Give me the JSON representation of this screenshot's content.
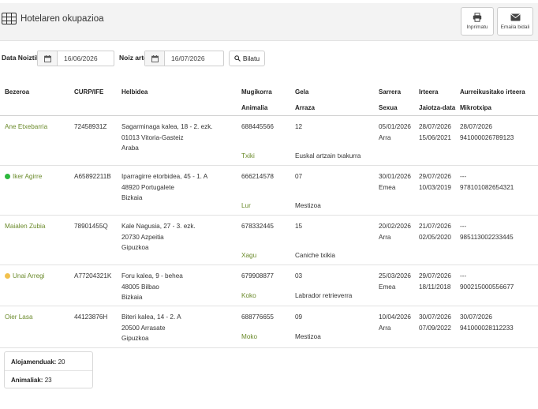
{
  "header": {
    "title": "Hotelaren okupazioa",
    "print_label": "Inprimatu",
    "email_label": "Emaila bidali"
  },
  "filters": {
    "from_label": "Data Noiztik",
    "from_value": "16/06/2026",
    "to_label": "Noiz arte",
    "to_value": "16/07/2026",
    "search_label": "Bilatu"
  },
  "table": {
    "headers": {
      "guest": "Bezeroa",
      "curp": "CURP/IFE",
      "address": "Helbidea",
      "phone": "Mugikorra",
      "animal": "Animalia",
      "room": "Gela",
      "breed": "Arraza",
      "checkin": "Sarrera",
      "sex": "Sexua",
      "checkout": "Irteera",
      "birth": "Jaiotza-data",
      "prev_checkout": "Aurreikusitako irteera",
      "chip": "Mikrotxipa"
    },
    "rows": [
      {
        "guest": "Ane Etxebarria",
        "dot": "",
        "curp": "72458931Z",
        "addr1": "Sagarminaga kalea, 18 - 2. ezk.",
        "addr2": "01013 Vitoria-Gasteiz",
        "addr3": "Araba",
        "phone": "688445566",
        "pet": "Txiki",
        "room": "12",
        "breed": "Euskal artzain txakurra",
        "checkin": "05/01/2026",
        "sex": "Arra",
        "checkout": "28/07/2026",
        "birth": "15/06/2021",
        "prev_checkout": "28/07/2026",
        "chip": "941000026789123"
      },
      {
        "guest": "Iker Agirre",
        "dot": "#2db83d",
        "curp": "A65892211B",
        "addr1": "Iparragirre etorbidea, 45 - 1. A",
        "addr2": "48920 Portugalete",
        "addr3": "Bizkaia",
        "phone": "666214578",
        "pet": "Lur",
        "room": "07",
        "breed": "Mestizoa",
        "checkin": "30/01/2026",
        "sex": "Emea",
        "checkout": "29/07/2026",
        "birth": "10/03/2019",
        "prev_checkout": "---",
        "chip": "978101082654321"
      },
      {
        "guest": "Maialen Zubia",
        "dot": "",
        "curp": "78901455Q",
        "addr1": "Kale Nagusia, 27 - 3. ezk.",
        "addr2": "20730 Azpeitia",
        "addr3": "Gipuzkoa",
        "phone": "678332445",
        "pet": "Xagu",
        "room": "15",
        "breed": "Caniche txikia",
        "checkin": "20/02/2026",
        "sex": "Arra",
        "checkout": "21/07/2026",
        "birth": "02/05/2020",
        "prev_checkout": "---",
        "chip": "985113002233445"
      },
      {
        "guest": "Unai Arregi",
        "dot": "#f2c14e",
        "curp": "A77204321K",
        "addr1": "Foru kalea, 9 - behea",
        "addr2": "48005 Bilbao",
        "addr3": "Bizkaia",
        "phone": "679908877",
        "pet": "Koko",
        "room": "03",
        "breed": "Labrador retrieverra",
        "checkin": "25/03/2026",
        "sex": "Emea",
        "checkout": "29/07/2026",
        "birth": "18/11/2018",
        "prev_checkout": "---",
        "chip": "900215000556677"
      },
      {
        "guest": "Oier Lasa",
        "dot": "",
        "curp": "44123876H",
        "addr1": "Biteri kalea, 14 - 2. A",
        "addr2": "20500 Arrasate",
        "addr3": "Gipuzkoa",
        "phone": "688776655",
        "pet": "Moko",
        "room": "09",
        "breed": "Mestizoa",
        "checkin": "10/04/2026",
        "sex": "Arra",
        "checkout": "30/07/2026",
        "birth": "07/09/2022",
        "prev_checkout": "30/07/2026",
        "chip": "941000028112233"
      }
    ]
  },
  "summary": {
    "stays_label": "Alojamenduak:",
    "stays_value": "20",
    "animals_label": "Animaliak:",
    "animals_value": "23"
  }
}
